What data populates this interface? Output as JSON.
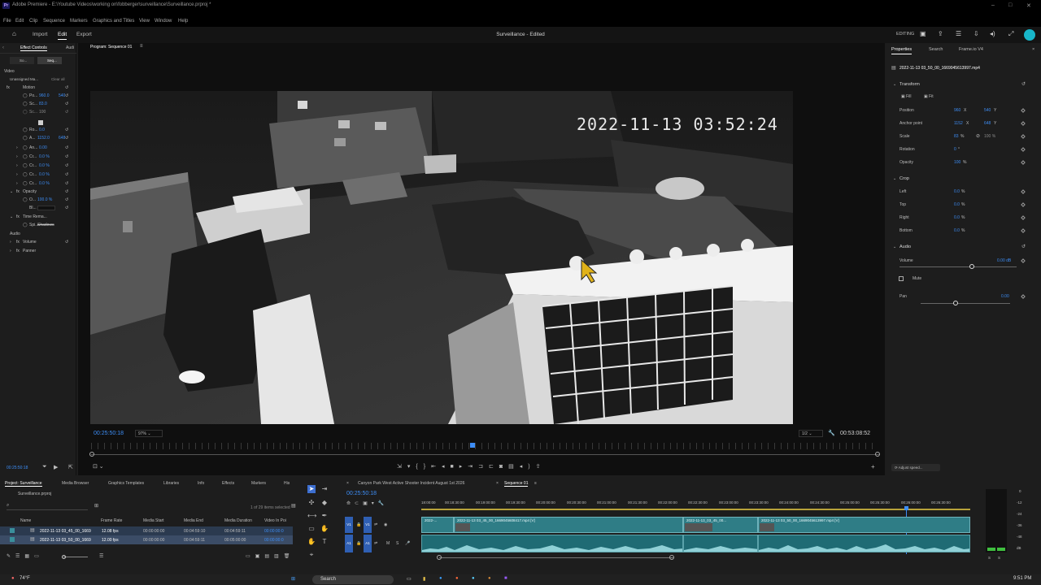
{
  "window": {
    "app_title": "Adobe Premiere - E:\\Youtube Videos\\working on\\fobberger\\surveillance\\Surveillance.prproj *",
    "menu": [
      "File",
      "Edit",
      "Clip",
      "Sequence",
      "Markers",
      "Graphics and Titles",
      "View",
      "Window",
      "Help"
    ]
  },
  "workspace": {
    "tabs": [
      "Import",
      "Edit",
      "Export"
    ],
    "active_tab": "Edit",
    "center_title": "Surveillance - Edited",
    "mode_label": "EDITING"
  },
  "effect_controls": {
    "tabs": [
      "Effect Controls",
      "Audi"
    ],
    "source_label": "So...",
    "sequence_label": "Seq...",
    "video_label": "Video",
    "clip_label": "Unassigned Ma...",
    "clear_label": "Clear all",
    "rows": [
      {
        "name": "Motion",
        "value": ""
      },
      {
        "name": "Po...",
        "value": "960.0",
        "value2": "540"
      },
      {
        "name": "Sc...",
        "value": "83.0",
        "value2": ""
      },
      {
        "name": "Sc...",
        "value": "100",
        "value2": ""
      },
      {
        "name": "Ro...",
        "value": "0.0",
        "value2": ""
      },
      {
        "name": "A...",
        "value": "1152.0",
        "value2": "648"
      },
      {
        "name": "An...",
        "value": "0.00",
        "value2": ""
      },
      {
        "name": "Cr...",
        "value": "0.0 %",
        "value2": ""
      },
      {
        "name": "Cr...",
        "value": "0.0 %",
        "value2": ""
      },
      {
        "name": "Cr...",
        "value": "0.0 %",
        "value2": ""
      },
      {
        "name": "Cr...",
        "value": "0.0 %",
        "value2": ""
      },
      {
        "name": "Opacity",
        "value": ""
      },
      {
        "name": "O...",
        "value": "100.0 %",
        "value2": ""
      },
      {
        "name": "Bl...",
        "value": "",
        "value2": ""
      },
      {
        "name": "Time Rema...",
        "value": ""
      },
      {
        "name": "Spi...",
        "value": "Shadows",
        "value2": ""
      }
    ],
    "audio_label": "Audio",
    "audio_rows": [
      "Volume",
      "Panner"
    ],
    "timecode": "00:25:50:18"
  },
  "program": {
    "title": "Program: Sequence 01",
    "timecode_left": "00:25:50:18",
    "zoom": "97%",
    "resolution": "1/2",
    "timecode_right": "00:53:08:52",
    "osd_timestamp": "2022-11-13  03:52:24"
  },
  "properties": {
    "tabs": [
      "Properties",
      "Search",
      "Frame.io V4"
    ],
    "file_name": "2022-11-13 03_50_00_1669045613997.mp4",
    "transform_label": "Transform",
    "fill_label": "Fill",
    "fit_label": "Fit",
    "position_label": "Position",
    "position_x": "960",
    "position_y": "540",
    "anchor_label": "Anchor point",
    "anchor_x": "1152",
    "anchor_y": "648",
    "scale_label": "Scale",
    "scale_value": "83",
    "scale_value2": "100",
    "rotation_label": "Rotation",
    "rotation_value": "0",
    "opacity_label": "Opacity",
    "opacity_value": "100",
    "crop_label": "Crop",
    "crop_left_label": "Left",
    "crop_left": "0.0",
    "crop_top_label": "Top",
    "crop_top": "0.0",
    "crop_right_label": "Right",
    "crop_right": "0.0",
    "crop_bottom_label": "Bottom",
    "crop_bottom": "0.0",
    "audio_label": "Audio",
    "volume_label": "Volume",
    "volume_value": "0.00 dB",
    "mute_label": "Mute",
    "pan_label": "Pan",
    "pan_value": "0.00",
    "adjust_speed": "Adjust speed..."
  },
  "project": {
    "tabs": [
      "Project: Surveillance",
      "Media Browser",
      "Graphics Templates",
      "Libraries",
      "Info",
      "Effects",
      "Markers",
      "His"
    ],
    "file": "Surveillance.prproj",
    "selection_info": "1 of 29 items selected",
    "columns": [
      "Name",
      "Frame Rate",
      "Media Start",
      "Media End",
      "Media Duration",
      "Video In Poi"
    ],
    "rows": [
      [
        "2022-11-13 03_45_00_1669",
        "12.08 fps",
        "00:00:00:00",
        "00:04:59:10",
        "00:04:59:11",
        "00:00:00:0"
      ],
      [
        "2022-11-13 03_50_00_1669",
        "12.00 fps",
        "00:00:00:00",
        "00:04:59:11",
        "00:05:00:00",
        "00:00:00:0"
      ]
    ]
  },
  "timeline": {
    "tabs": [
      "Canyon Park West Active Shooter Incident August 1st 2026",
      "Sequence 01"
    ],
    "timecode": "00:25:50:18",
    "ruler": [
      "18:00:00",
      "00:18:30:00",
      "00:19:00:00",
      "00:19:30:00",
      "00:20:00:00",
      "00:20:30:00",
      "00:21:00:00",
      "00:21:30:00",
      "00:22:00:00",
      "00:22:30:00",
      "00:23:00:00",
      "00:23:30:00",
      "00:24:00:00",
      "00:24:30:00",
      "00:25:00:00",
      "00:25:30:00",
      "00:26:00:00",
      "00:26:30:00"
    ],
    "tracks": [
      "V1",
      "A1"
    ],
    "clips": [
      "2022-...",
      "2022-11-13 03_45_00_1669045608417.mp4 [V]",
      "2022-11-13_03_45_00...",
      "2022-11-13 03_50_00_1669045613997.mp4 [V]"
    ]
  },
  "meters": {
    "scale": [
      "0",
      "-12",
      "-24",
      "-36",
      "-48",
      "dB"
    ],
    "labels": [
      "S",
      "S"
    ]
  },
  "taskbar": {
    "weather": "74°F",
    "search": "Search",
    "time": "9:51 PM"
  }
}
